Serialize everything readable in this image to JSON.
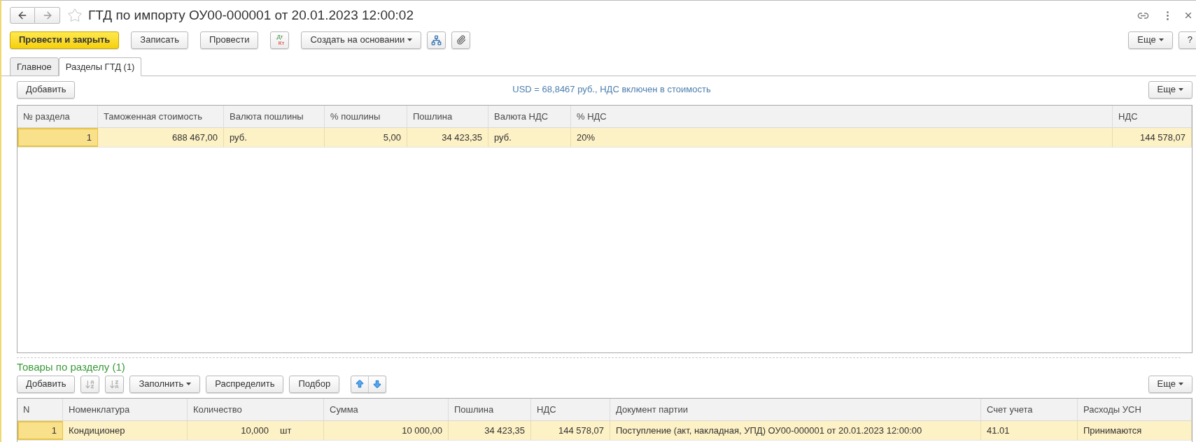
{
  "window": {
    "title": "ГТД по импорту ОУ00-000001 от 20.01.2023 12:00:02",
    "favorite": false
  },
  "toolbar": [
    {
      "kind": "primary",
      "label": "Провести и закрыть"
    },
    {
      "kind": "plain",
      "label": "Записать"
    },
    {
      "kind": "plain",
      "label": "Провести"
    },
    {
      "kind": "dtkt",
      "top": "Дт",
      "bottom": "Кт"
    },
    {
      "kind": "dropdown",
      "label": "Создать на основании"
    },
    {
      "kind": "structure"
    },
    {
      "kind": "attach"
    }
  ],
  "toolbar_right": [
    {
      "kind": "dropdown",
      "label": "Еще"
    },
    {
      "kind": "plain",
      "label": "?"
    }
  ],
  "tabs": [
    {
      "label": "Главное",
      "selected": false
    },
    {
      "label": "Разделы ГТД (1)",
      "selected": true
    }
  ],
  "sections": {
    "add_button": "Добавить",
    "info": "USD = 68,8467 руб., НДС включен в стоимость",
    "more_button": "Еще",
    "table": {
      "columns": [
        "№ раздела",
        "Таможенная стоимость",
        "Валюта пошлины",
        "% пошлины",
        "Пошлина",
        "Валюта НДС",
        "% НДС",
        "НДС"
      ],
      "rows": [
        {
          "selected": true,
          "cells": [
            "1",
            "688 467,00",
            "руб.",
            "5,00",
            "34 423,35",
            "руб.",
            "20%",
            "144 578,07"
          ]
        }
      ]
    }
  },
  "goods": {
    "title": "Товары по разделу (1)",
    "toolbar": [
      {
        "kind": "plain",
        "label": "Добавить"
      },
      {
        "kind": "sort-asc",
        "disabled": true
      },
      {
        "kind": "sort-desc",
        "disabled": true
      },
      {
        "kind": "dropdown",
        "label": "Заполнить"
      },
      {
        "kind": "plain",
        "label": "Распределить"
      },
      {
        "kind": "plain",
        "label": "Подбор"
      },
      {
        "kind": "move-up"
      },
      {
        "kind": "move-down"
      }
    ],
    "more_button": "Еще",
    "table": {
      "columns": [
        "N",
        "Номенклатура",
        "Количество",
        "Сумма",
        "Пошлина",
        "НДС",
        "Документ партии",
        "Счет учета",
        "Расходы УСН"
      ],
      "rows": [
        {
          "selected": true,
          "cells": [
            "1",
            "Кондиционер",
            {
              "value": "10,000",
              "unit": "шт"
            },
            "10 000,00",
            "34 423,35",
            "144 578,07",
            "Поступление (акт, накладная, УПД) ОУ00-000001 от 20.01.2023 12:00:00",
            "41.01",
            "Принимаются"
          ]
        }
      ]
    }
  }
}
